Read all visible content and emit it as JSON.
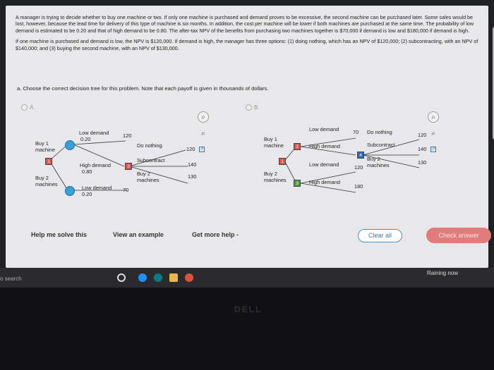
{
  "question": {
    "paragraph1": "A manager is trying to decide whether to buy one machine or two. If only one machine is purchased and demand proves to be excessive, the second machine can be purchased later. Some sales would be lost, however, because the lead time for delivery of this type of machine is six months. In addition, the cost per machine will be lower if both machines are purchased at the same time. The probability of low demand is estimated to be 0.20 and that of high demand to be 0.80. The after-tax NPV of the benefits from purchasing two machines together is $70,000 if demand is low and $180,000 if demand is high.",
    "paragraph2": "If one machine is purchased and demand is low, the NPV is $120,000. If demand is high, the manager has three options: (1) doing nothing, which has an NPV of $120,000; (2) subcontracting, with an NPV of $140,000; and (3) buying the second machine, with an NPV of $130,000.",
    "part_a": "a. Choose the correct decision tree for this problem. Note that each payoff is given in thousands of dollars."
  },
  "choices": {
    "a": "A.",
    "b": "B."
  },
  "tree_a": {
    "buy1": "Buy 1\nmachine",
    "buy2": "Buy 2\nmachines",
    "low_demand_top": "Low demand",
    "p_low_top": "0.20",
    "v_low_top": "120",
    "high_demand": "High demand",
    "p_high": "0.80",
    "do_nothing": "Do nothing",
    "v_do_nothing": "120",
    "subcontract": "Subcontract",
    "v_subcontract": "140",
    "buy2_option": "Buy 2\nmachines",
    "v_buy2_option": "130",
    "low_demand_bottom": "Low demand",
    "p_low_bottom": "0.20",
    "v_low_bottom": "70",
    "sq1": "1",
    "sq2": "2"
  },
  "tree_b": {
    "buy1": "Buy 1\nmachine",
    "buy2": "Buy 2\nmachines",
    "low_demand_top": "Low demand",
    "v_low_top": "70",
    "high_demand_top": "High demand",
    "do_nothing": "Do nothing",
    "v_do_nothing": "120",
    "subcontract": "Subcontract",
    "v_subcontract": "140",
    "buy2_option": "Buy 2\nmachines",
    "v_buy2_option": "130",
    "low_demand_bottom": "Low demand",
    "v_low_bottom": "120",
    "high_demand_bottom": "High demand",
    "v_high_bottom": "180",
    "sq1": "1",
    "sq2": "2",
    "sq3": "3",
    "sq4": "4"
  },
  "buttons": {
    "help": "Help me solve this",
    "example": "View an example",
    "more_help": "Get more help -",
    "clear": "Clear all",
    "check": "Check answer"
  },
  "taskbar": {
    "search": "o search",
    "weather": "Raining now"
  },
  "brand": "DELL",
  "colors": {
    "accent": "#3a7ab4",
    "check_button": "#e27b7b",
    "node_circle": "#3aa0d8"
  }
}
